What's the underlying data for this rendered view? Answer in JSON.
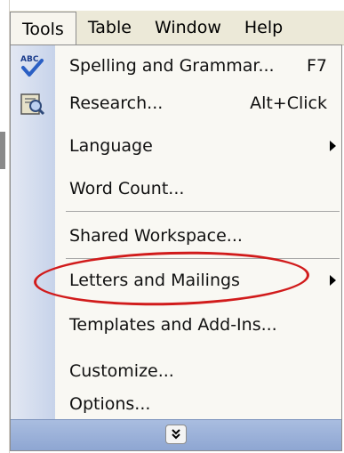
{
  "menubar": {
    "items": [
      {
        "label": "Tools"
      },
      {
        "label": "Table"
      },
      {
        "label": "Window"
      },
      {
        "label": "Help"
      }
    ]
  },
  "menu": {
    "items": [
      {
        "label": "Spelling and Grammar...",
        "shortcut": "F7",
        "icon": "spelling-abc-check-icon"
      },
      {
        "label": "Research...",
        "shortcut": "Alt+Click",
        "icon": "research-book-icon"
      },
      {
        "label": "Language",
        "submenu": true
      },
      {
        "label": "Word Count..."
      },
      {
        "label": "Shared Workspace..."
      },
      {
        "label": "Letters and Mailings",
        "submenu": true
      },
      {
        "label": "Templates and Add-Ins...",
        "highlighted": true
      },
      {
        "label": "Customize..."
      },
      {
        "label": "Options..."
      }
    ],
    "expand_icon": "double-chevron-down-icon"
  },
  "colors": {
    "highlight_oval": "#d11b1b",
    "icon_gutter": "#c7d3ea",
    "expand_bar": "#8ea6d2"
  }
}
